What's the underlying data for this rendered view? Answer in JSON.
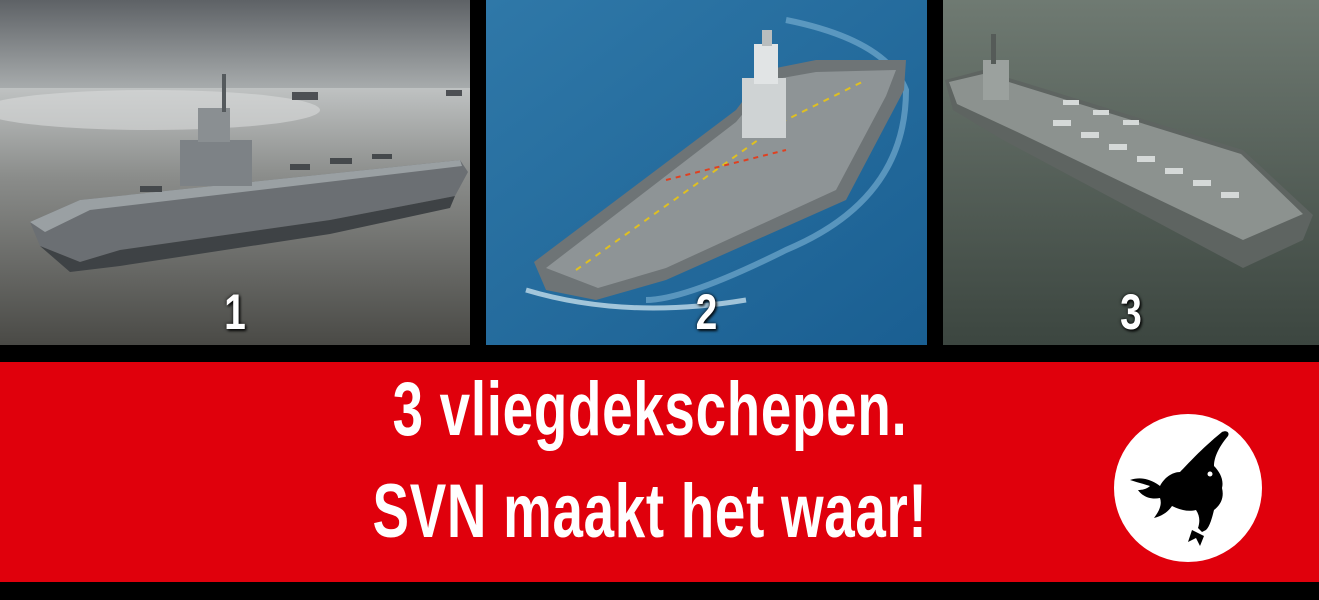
{
  "photos": [
    {
      "number": "1",
      "subject": "aircraft-carrier-grey-sea"
    },
    {
      "number": "2",
      "subject": "aircraft-carrier-blue-sea"
    },
    {
      "number": "3",
      "subject": "aircraft-carrier-green-sea"
    }
  ],
  "banner": {
    "line1": "3 vliegdekschepen.",
    "line2": "SVN maakt het waar!",
    "background_color": "#e0000c",
    "text_color": "#ffffff"
  },
  "logo": {
    "icon": "crow-icon",
    "circle_color": "#ffffff",
    "bird_color": "#000000"
  }
}
